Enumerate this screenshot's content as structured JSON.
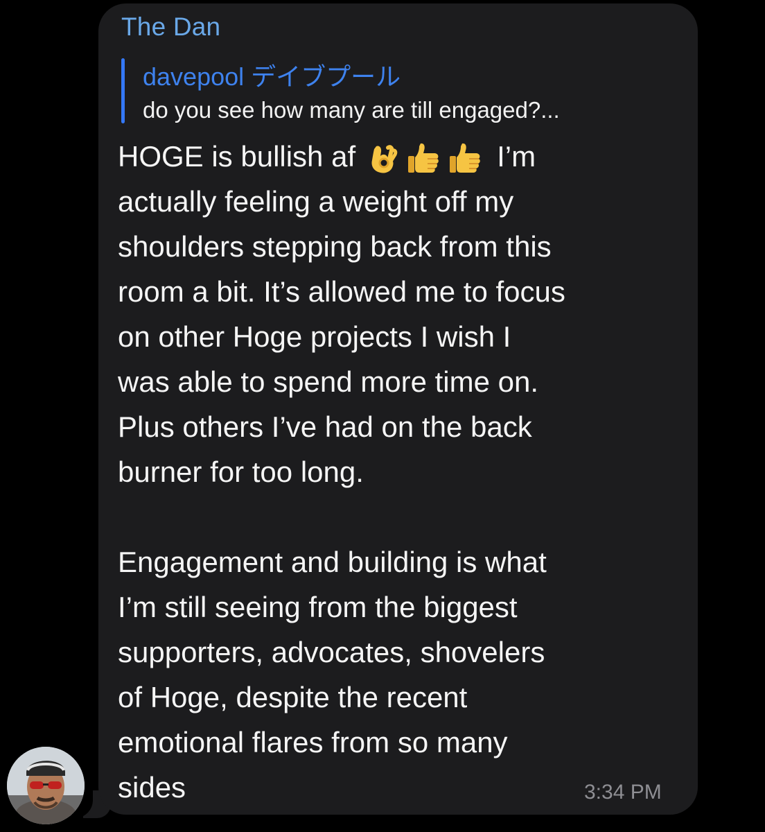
{
  "sender": {
    "name": "The Dan"
  },
  "reply": {
    "author": "davepool デイブプール",
    "text": "do you see how many are till engaged?..."
  },
  "message": {
    "line1_start": "HOGE is bullish af",
    "emojis": [
      "ok-hand-icon",
      "thumbs-up-icon",
      "thumbs-up-icon"
    ],
    "line1_end": "I’m",
    "lines_paragraph1": [
      "actually feeling a weight off my",
      "shoulders stepping back from this",
      "room a bit. It’s allowed me to focus",
      "on other Hoge projects I wish I",
      "was able to spend more time on.",
      "Plus others I’ve had on the back",
      "burner for too long."
    ],
    "lines_paragraph2": [
      "Engagement and building is what",
      "I’m still seeing from the biggest",
      "supporters, advocates, shovelers",
      "of Hoge, despite the recent",
      "emotional flares from so many",
      "sides"
    ]
  },
  "timestamp": "3:34 PM",
  "colors": {
    "background": "#000000",
    "bubble": "#1c1c1e",
    "sender_name": "#6aa8e8",
    "reply_accent": "#3478f6",
    "text": "#f5f5f5",
    "timestamp": "#8e8e93"
  }
}
